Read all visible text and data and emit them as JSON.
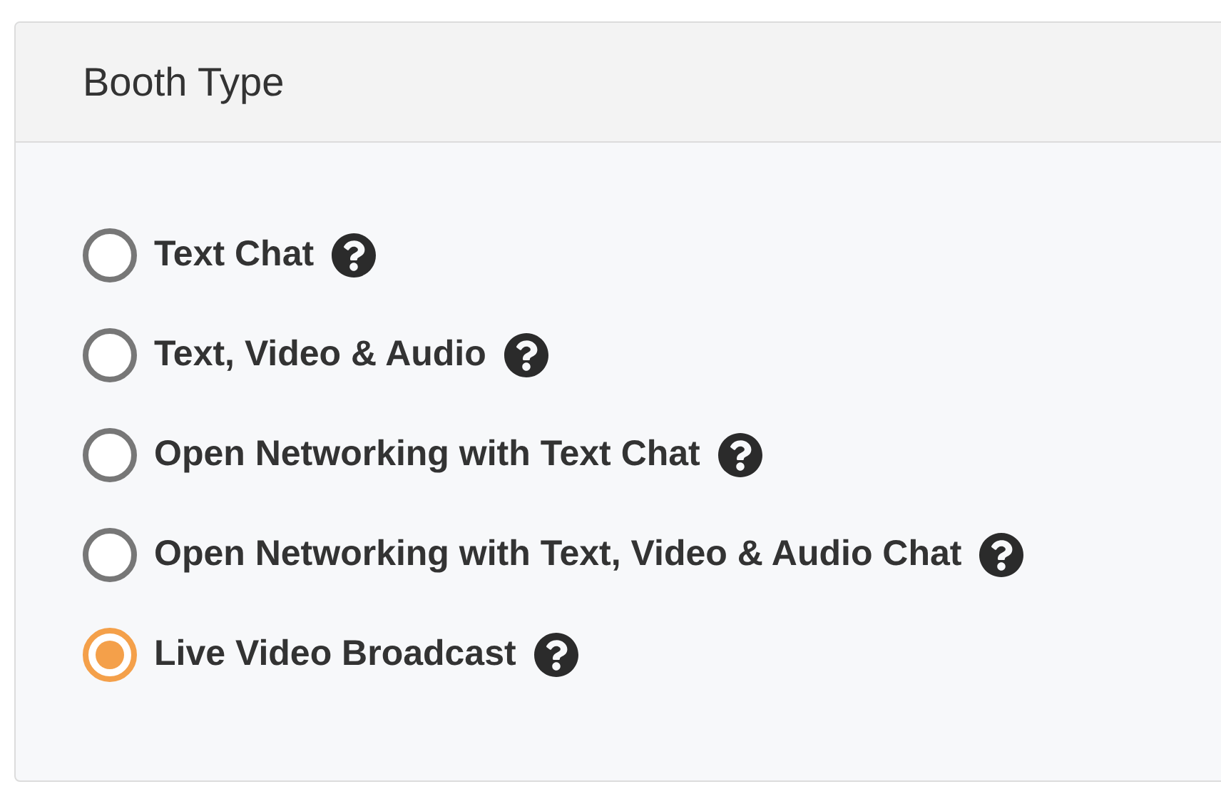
{
  "panel": {
    "title": "Booth Type"
  },
  "options": [
    {
      "label": "Text Chat",
      "selected": false
    },
    {
      "label": "Text, Video & Audio",
      "selected": false
    },
    {
      "label": "Open Networking with Text Chat",
      "selected": false
    },
    {
      "label": "Open Networking with Text, Video & Audio Chat",
      "selected": false
    },
    {
      "label": "Live Video Broadcast",
      "selected": true
    }
  ]
}
